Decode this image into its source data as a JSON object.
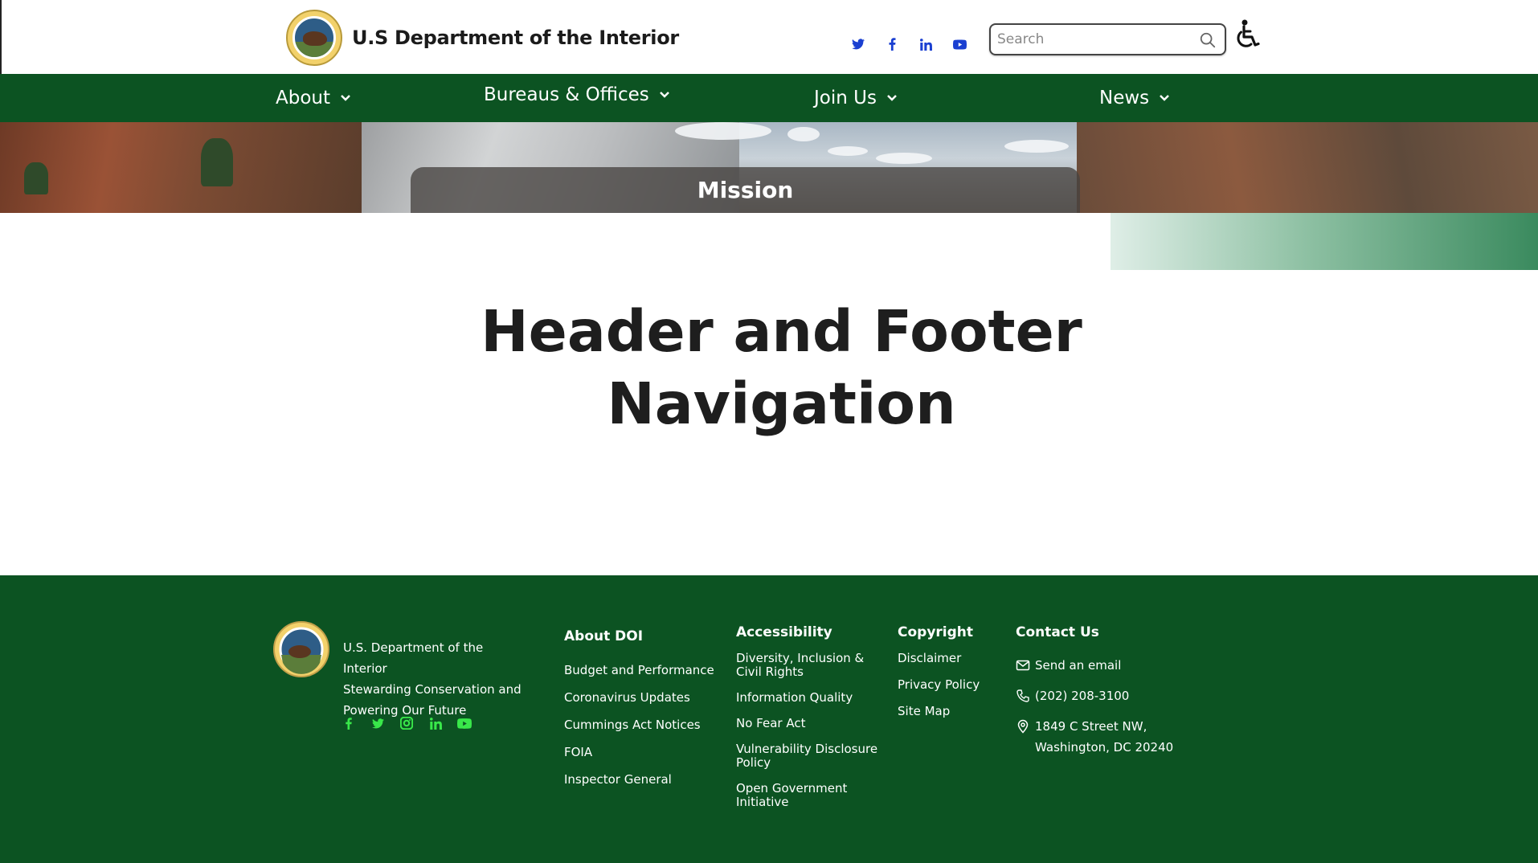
{
  "header": {
    "org_name": "U.S Department of the Interior",
    "social_icons": [
      "twitter-icon",
      "facebook-icon",
      "linkedin-icon",
      "youtube-icon"
    ],
    "search_placeholder": "Search",
    "accent_color": "#1a3fd1"
  },
  "nav": {
    "items": [
      {
        "label": "About"
      },
      {
        "label": "Bureaus & Offices"
      },
      {
        "label": "Join Us"
      },
      {
        "label": "News"
      }
    ],
    "background": "#0c5322"
  },
  "hero": {
    "mission_label": "Mission"
  },
  "main": {
    "title_line1": "Header and Footer",
    "title_line2": "Navigation"
  },
  "footer": {
    "org_line1": "U.S. Department of the Interior",
    "org_line2": "Stewarding Conservation and",
    "org_line3": "Powering Our Future",
    "social_icons": [
      "facebook-icon",
      "twitter-icon",
      "instagram-icon",
      "linkedin-icon",
      "youtube-icon"
    ],
    "social_color": "#39e84a",
    "about": {
      "heading": "About DOI",
      "links": [
        "Budget and Performance",
        "Coronavirus Updates",
        "Cummings Act Notices",
        "FOIA",
        "Inspector General"
      ]
    },
    "accessibility": {
      "heading": "Accessibility",
      "links": [
        "Diversity, Inclusion & Civil Rights",
        "Information Quality",
        "No Fear Act",
        "Vulnerability Disclosure Policy",
        "Open Government Initiative"
      ]
    },
    "copyright": {
      "heading": "Copyright",
      "links": [
        "Disclaimer",
        "Privacy Policy",
        "Site Map"
      ]
    },
    "contact": {
      "heading": "Contact Us",
      "email_label": "Send an email",
      "phone": "(202) 208-3100",
      "address_line1": "1849 C Street NW,",
      "address_line2": "Washington, DC 20240"
    }
  }
}
